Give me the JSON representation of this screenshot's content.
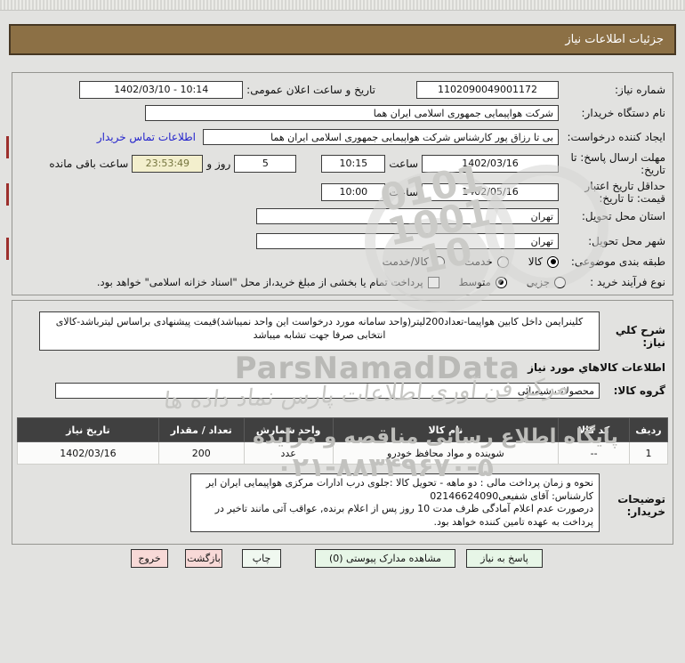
{
  "title_bar": {
    "text": "جزئیات اطلاعات نیاز"
  },
  "form": {
    "need_number": {
      "label": "شماره نیاز:",
      "value": "1102090049001172"
    },
    "announce_datetime": {
      "label": "تاریخ و ساعت اعلان عمومی:",
      "value": "1402/03/10 - 10:14"
    },
    "buyer_org": {
      "label": "نام دستگاه خریدار:",
      "value": "شرکت هواپیمایی جمهوری اسلامی ایران هما"
    },
    "request_creator": {
      "label": "ایجاد کننده درخواست:",
      "value": "بی تا رزاق پور کارشناس شرکت هواپیمایی جمهوری اسلامی ایران هما",
      "contact_link": "اطلاعات تماس خریدار"
    },
    "response_deadline": {
      "label": "مهلت ارسال پاسخ: تا تاریخ:",
      "date": "1402/03/16",
      "hour_label": "ساعت",
      "time": "10:15",
      "days": "5",
      "days_label": "روز و",
      "countdown": "23:53:49",
      "countdown_label": "ساعت باقی مانده"
    },
    "price_validity": {
      "label": "حداقل تاریخ اعتبار قیمت: تا تاریخ:",
      "date": "1402/05/16",
      "hour_label": "ساعت",
      "time": "10:00"
    },
    "province": {
      "label": "استان محل تحویل:",
      "value": "تهران"
    },
    "city": {
      "label": "شهر محل تحویل:",
      "value": "تهران"
    },
    "classification": {
      "label": "طبقه بندی موضوعی:",
      "options": [
        {
          "label": "کالا",
          "selected": true
        },
        {
          "label": "خدمت",
          "selected": false
        },
        {
          "label": "کالا/خدمت",
          "selected": false
        }
      ]
    },
    "purchase_process": {
      "label": "نوع فرآیند خرید :",
      "options": [
        {
          "label": "جزیی",
          "selected": false
        },
        {
          "label": "متوسط",
          "selected": true
        }
      ],
      "checkbox_checked": false,
      "checkbox_label": "پرداخت تمام یا بخشی از مبلغ خرید،از محل \"اسناد خزانه اسلامی\" خواهد بود."
    }
  },
  "need_description": {
    "label": "شرح کلي نیاز:",
    "value": "کلینرایمن داخل کابین هواپیما-تعداد200لیتر(واحد سامانه مورد درخواست این واحد نمیباشد)قیمت پیشنهادی براساس لیترباشد-کالای انتخابی صرفا جهت تشابه میباشد"
  },
  "goods_section": {
    "header": "اطلاعات کالاهاي مورد نیاز",
    "group_label": "گروه کالا:",
    "group_value": "محصولات شیمیائی"
  },
  "goods_table": {
    "headers": [
      "ردیف",
      "کد کالا",
      "نام کالا",
      "واحد شمارش",
      "تعداد / مقدار",
      "تاریخ نیاز"
    ],
    "rows": [
      [
        "1",
        "--",
        "شوینده و مواد محافظ خودرو",
        "عدد",
        "200",
        "1402/03/16"
      ]
    ]
  },
  "buyer_notes": {
    "label": "توضیحات خریدار:",
    "value": "نحوه و زمان پرداخت مالی : دو ماهه - تحویل کالا :جلوی درب ادارات مرکزی هواپیمایی ایران ایر\nکارشناس: آقای شفیعی02146624090\nدرصورت عدم اعلام آمادگی ظرف مدت 10 روز پس از اعلام برنده, عواقب آتی مانند تاخیر در پرداخت به عهده تامین کننده خواهد بود."
  },
  "buttons": [
    {
      "label": "پاسخ به نیاز",
      "type": "green"
    },
    {
      "label": "مشاهده مدارک پیوستی (0)",
      "type": "green"
    },
    {
      "label": "چاپ",
      "type": "lgreen"
    },
    {
      "label": "بازگشت",
      "type": "pink"
    },
    {
      "label": "خروج",
      "type": "pink"
    }
  ],
  "watermarks": {
    "brand": "ParsNamadData",
    "calligraphy": "مرکز فن آوری اطلاعات پارس نماد داده ها",
    "portal": "پایگاه اطلاع رسانی مناقصه و مزایده",
    "phone": "۰۲۱-۸۸۳۴۹۶۷۰-۵",
    "digits": "0101\n1001\n10"
  },
  "colors": {
    "title_bar_bg": "#8c7045",
    "countdown_bg": "#f3efcd",
    "table_header_bg": "#404040",
    "button_green": "#e7f6e7",
    "button_pink": "#f8d9d7",
    "link_blue": "#2424cc"
  }
}
